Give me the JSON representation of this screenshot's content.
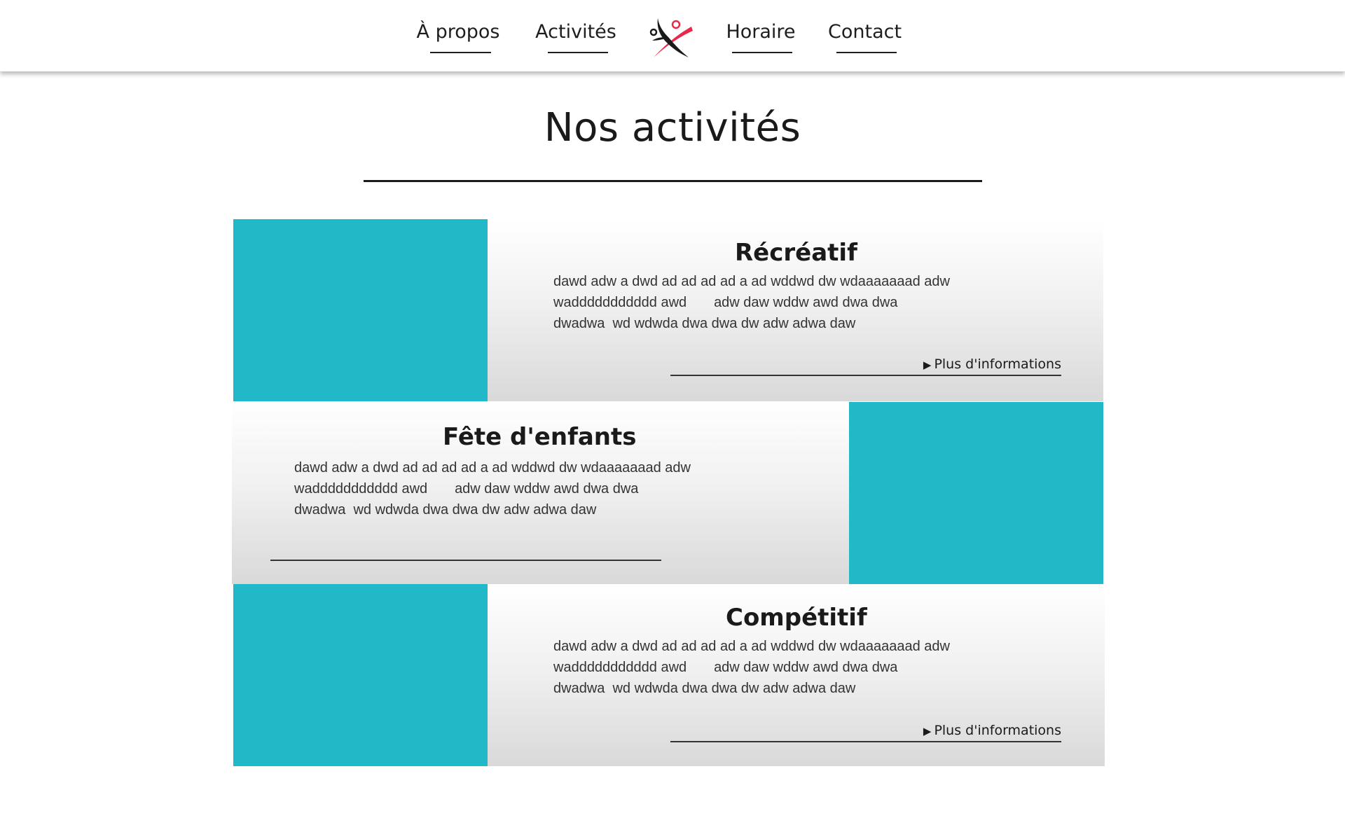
{
  "nav": {
    "about": "À propos",
    "activities": "Activités",
    "schedule": "Horaire",
    "contact": "Contact"
  },
  "logo": {
    "icon": "gymnast-logo-icon",
    "colors": {
      "figure": "#1a1a1a",
      "accent": "#e8294a"
    }
  },
  "page_title": "Nos activités",
  "colors": {
    "photo_placeholder": "#21b9c7",
    "text": "#1a1a1a"
  },
  "cards": [
    {
      "title": "Récréatif",
      "desc_lines": [
        "dawd adw a dwd ad ad ad ad a ad wddwd dw wdaaaaaaad adw",
        "waddddddddddd awd       adw daw wddw awd dwa dwa",
        "dwadwa  wd wdwda dwa dwa dw adw adwa daw"
      ],
      "more_label": "Plus d'informations",
      "more_icon": "play-triangle-icon"
    },
    {
      "title": "Fête d'enfants",
      "desc_lines": [
        "dawd adw a dwd ad ad ad ad a ad wddwd dw wdaaaaaaad adw",
        "waddddddddddd awd       adw daw wddw awd dwa dwa",
        "dwadwa  wd wdwda dwa dwa dw adw adwa daw"
      ]
    },
    {
      "title": "Compétitif",
      "desc_lines": [
        "dawd adw a dwd ad ad ad ad a ad wddwd dw wdaaaaaaad adw",
        "waddddddddddd awd       adw daw wddw awd dwa dwa",
        "dwadwa  wd wdwda dwa dwa dw adw adwa daw"
      ],
      "more_label": "Plus d'informations",
      "more_icon": "play-triangle-icon"
    }
  ]
}
